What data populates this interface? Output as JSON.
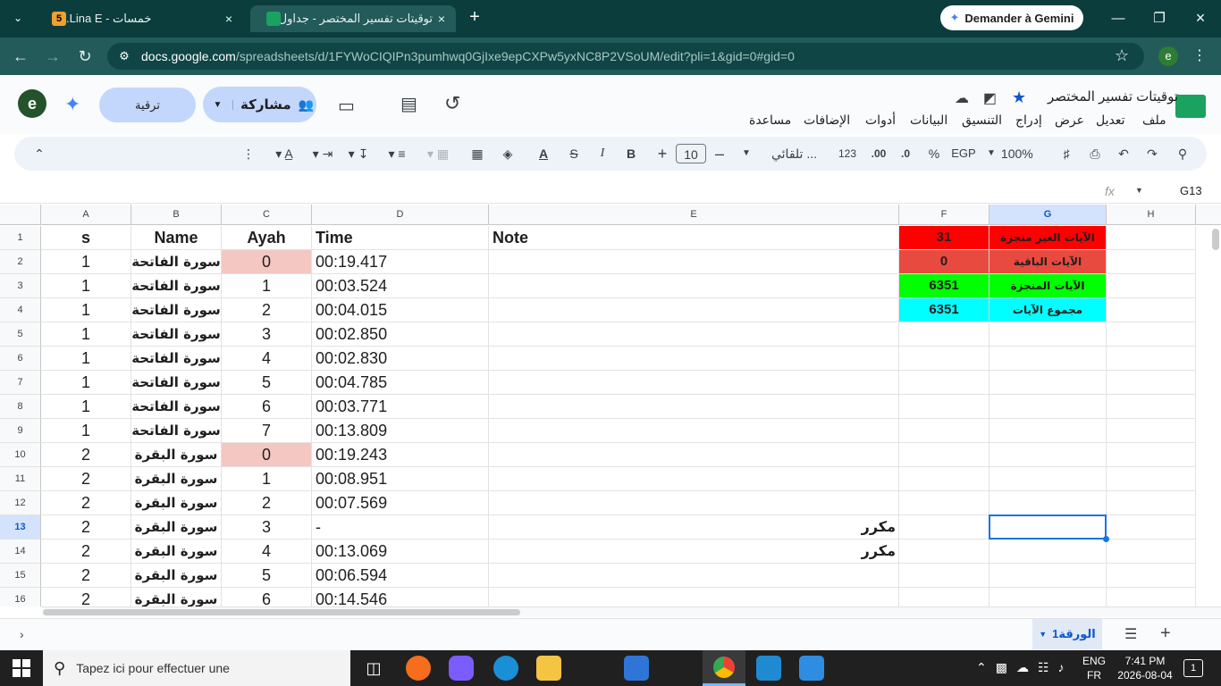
{
  "browser": {
    "tabs": [
      {
        "title": "خمسات - Lina E.",
        "favicon_text": "5",
        "active": false
      },
      {
        "title": "توقيتات تفسير المختصر - جداول بـ",
        "active": true
      }
    ],
    "new_tab_label": "+",
    "gemini_button": "Demander à Gemini",
    "url_host": "docs.google.com",
    "url_path": "/spreadsheets/d/1FYWoCIQIPn3pumhwq0GjIxe9epCXPw5yxNC8P2VSoUM/edit?pli=1&gid=0#gid=0",
    "profile_letter": "e"
  },
  "doc": {
    "title": "توقيتات تفسير المختصر",
    "menu": [
      "ملف",
      "تعديل",
      "عرض",
      "إدراج",
      "التنسيق",
      "البيانات",
      "أدوات",
      "الإضافات",
      "مساعدة"
    ],
    "share_label": "مشاركة",
    "upgrade_label": "ترقية",
    "avatar_letter": "e"
  },
  "toolbar": {
    "zoom": "100%",
    "currency": "EGP",
    "percent": "%",
    "dec_decrease": ".0",
    "dec_increase": ".00",
    "format_123": "123",
    "font": "تلقائي ...",
    "font_size": "10"
  },
  "formula": {
    "name_box": "G13",
    "fx": "fx"
  },
  "columns": [
    "A",
    "B",
    "C",
    "D",
    "E",
    "F",
    "G",
    "H"
  ],
  "selected_col": "G",
  "selected_row": 13,
  "rows": [
    {
      "n": 1,
      "A": "s",
      "B": "Name",
      "C": "Ayah",
      "D": "Time",
      "E": "Note"
    },
    {
      "n": 2,
      "A": "1",
      "B": "سورة الفاتحة",
      "C": "0",
      "D": "00:19.417",
      "E": ""
    },
    {
      "n": 3,
      "A": "1",
      "B": "سورة الفاتحة",
      "C": "1",
      "D": "00:03.524",
      "E": ""
    },
    {
      "n": 4,
      "A": "1",
      "B": "سورة الفاتحة",
      "C": "2",
      "D": "00:04.015",
      "E": ""
    },
    {
      "n": 5,
      "A": "1",
      "B": "سورة الفاتحة",
      "C": "3",
      "D": "00:02.850",
      "E": ""
    },
    {
      "n": 6,
      "A": "1",
      "B": "سورة الفاتحة",
      "C": "4",
      "D": "00:02.830",
      "E": ""
    },
    {
      "n": 7,
      "A": "1",
      "B": "سورة الفاتحة",
      "C": "5",
      "D": "00:04.785",
      "E": ""
    },
    {
      "n": 8,
      "A": "1",
      "B": "سورة الفاتحة",
      "C": "6",
      "D": "00:03.771",
      "E": ""
    },
    {
      "n": 9,
      "A": "1",
      "B": "سورة الفاتحة",
      "C": "7",
      "D": "00:13.809",
      "E": ""
    },
    {
      "n": 10,
      "A": "2",
      "B": "سورة البقرة",
      "C": "0",
      "D": "00:19.243",
      "E": ""
    },
    {
      "n": 11,
      "A": "2",
      "B": "سورة البقرة",
      "C": "1",
      "D": "00:08.951",
      "E": ""
    },
    {
      "n": 12,
      "A": "2",
      "B": "سورة البقرة",
      "C": "2",
      "D": "00:07.569",
      "E": ""
    },
    {
      "n": 13,
      "A": "2",
      "B": "سورة البقرة",
      "C": "3",
      "D": "-",
      "E": "مكرر"
    },
    {
      "n": 14,
      "A": "2",
      "B": "سورة البقرة",
      "C": "4",
      "D": "00:13.069",
      "E": "مكرر"
    },
    {
      "n": 15,
      "A": "2",
      "B": "سورة البقرة",
      "C": "5",
      "D": "00:06.594",
      "E": ""
    },
    {
      "n": 16,
      "A": "2",
      "B": "سورة البقرة",
      "C": "6",
      "D": "00:14.546",
      "E": ""
    }
  ],
  "summary": [
    {
      "label": "الآيات الغير منجزة",
      "value": "31",
      "color": "#ff0000"
    },
    {
      "label": "الآيات الباقية",
      "value": "0",
      "color": "#e84a3f"
    },
    {
      "label": "الآيات المنجزة",
      "value": "6351",
      "color": "#00ff00"
    },
    {
      "label": "مجموع الآيات",
      "value": "6351",
      "color": "#00ffff"
    }
  ],
  "highlight_color": "#f4c7c3",
  "sheet_tab": "الورقة1",
  "taskbar": {
    "search_placeholder": "Tapez ici pour effectuer une",
    "lang_top": "ENG",
    "lang_bottom": "FR",
    "time": "7:41 PM",
    "date": "2026-08-04",
    "notifications": "1"
  }
}
